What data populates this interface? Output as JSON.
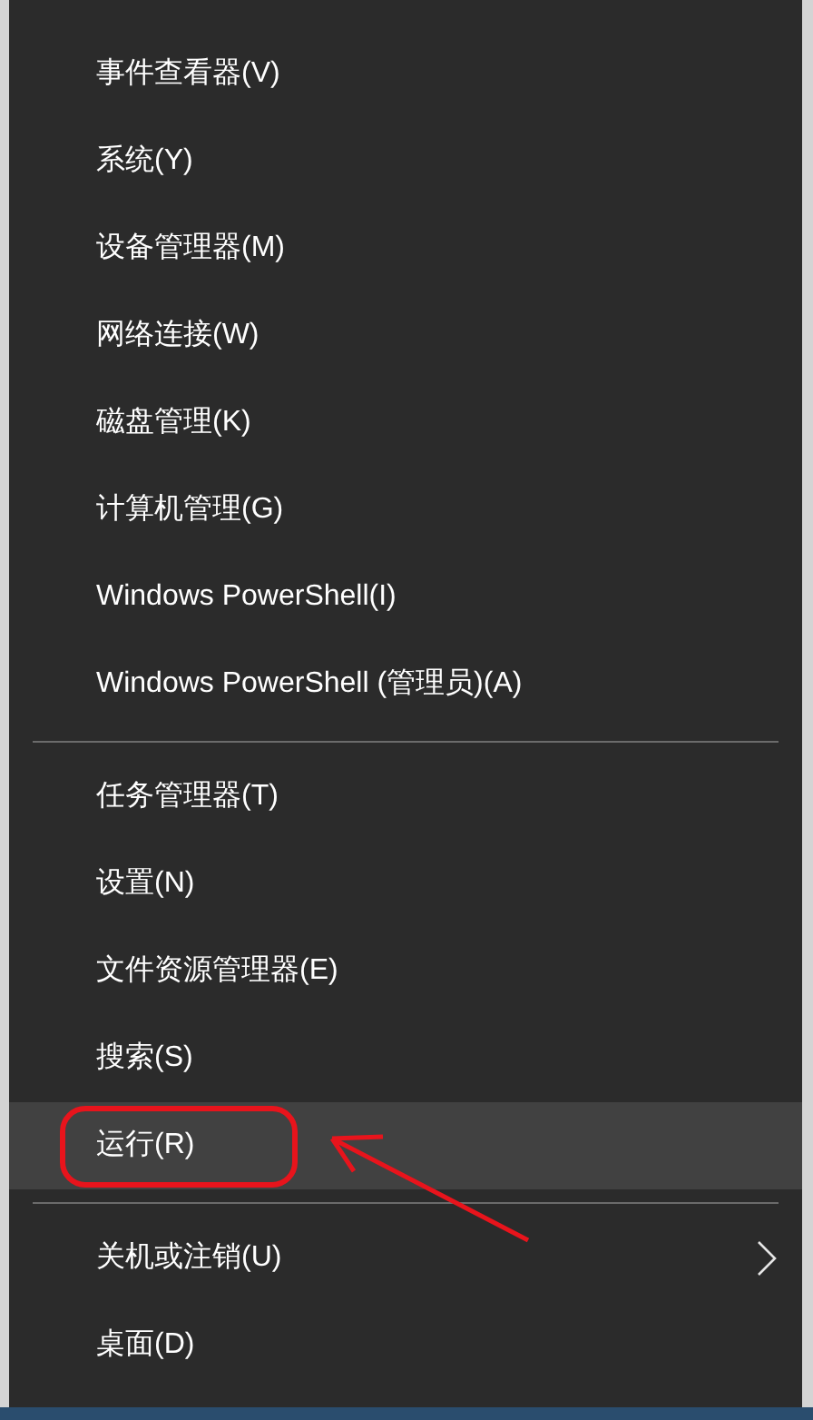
{
  "menu": {
    "items": [
      {
        "kind": "item",
        "label": "事件查看器(V)",
        "selected": false
      },
      {
        "kind": "item",
        "label": "系统(Y)",
        "selected": false
      },
      {
        "kind": "item",
        "label": "设备管理器(M)",
        "selected": false
      },
      {
        "kind": "item",
        "label": "网络连接(W)",
        "selected": false
      },
      {
        "kind": "item",
        "label": "磁盘管理(K)",
        "selected": false
      },
      {
        "kind": "item",
        "label": "计算机管理(G)",
        "selected": false
      },
      {
        "kind": "item",
        "label": "Windows PowerShell(I)",
        "selected": false
      },
      {
        "kind": "item",
        "label": "Windows PowerShell (管理员)(A)",
        "selected": false
      },
      {
        "kind": "divider"
      },
      {
        "kind": "item",
        "label": "任务管理器(T)",
        "selected": false
      },
      {
        "kind": "item",
        "label": "设置(N)",
        "selected": false
      },
      {
        "kind": "item",
        "label": "文件资源管理器(E)",
        "selected": false
      },
      {
        "kind": "item",
        "label": "搜索(S)",
        "selected": false
      },
      {
        "kind": "item",
        "label": "运行(R)",
        "selected": true,
        "annotated": true
      },
      {
        "kind": "divider"
      },
      {
        "kind": "submenu",
        "label": "关机或注销(U)",
        "selected": false
      },
      {
        "kind": "item",
        "label": "桌面(D)",
        "selected": false
      }
    ]
  }
}
